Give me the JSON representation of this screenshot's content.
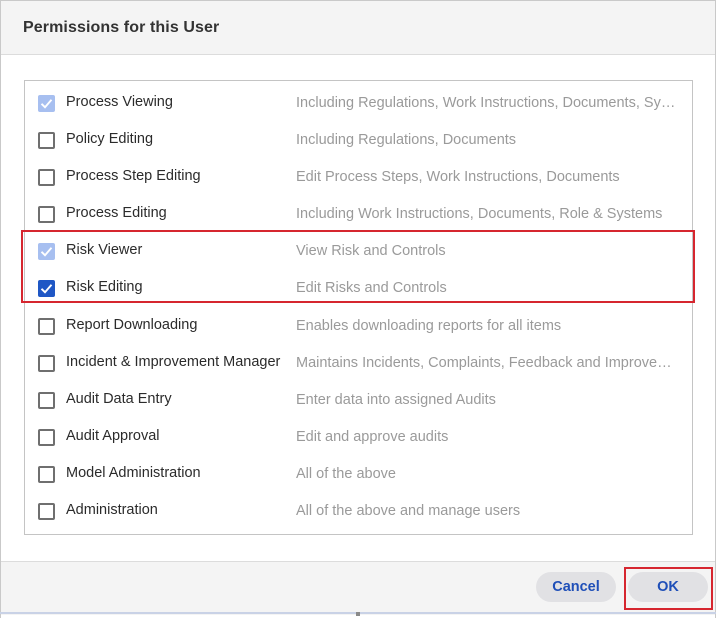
{
  "dialog": {
    "title": "Permissions for this User"
  },
  "permissions": [
    {
      "name": "Process Viewing",
      "description": "Including Regulations, Work Instructions, Documents, Sy…",
      "state": "checked-disabled"
    },
    {
      "name": "Policy Editing",
      "description": "Including Regulations, Documents",
      "state": "unchecked"
    },
    {
      "name": "Process Step Editing",
      "description": "Edit Process Steps, Work Instructions, Documents",
      "state": "unchecked"
    },
    {
      "name": "Process Editing",
      "description": "Including Work Instructions, Documents, Role & Systems",
      "state": "unchecked"
    },
    {
      "name": "Risk Viewer",
      "description": "View Risk and Controls",
      "state": "checked-disabled"
    },
    {
      "name": "Risk Editing",
      "description": "Edit Risks and Controls",
      "state": "checked"
    },
    {
      "name": "Report Downloading",
      "description": "Enables downloading reports for all items",
      "state": "unchecked"
    },
    {
      "name": "Incident & Improvement Manager",
      "description": "Maintains Incidents, Complaints, Feedback and Improve…",
      "state": "unchecked"
    },
    {
      "name": "Audit Data Entry",
      "description": "Enter data into assigned Audits",
      "state": "unchecked"
    },
    {
      "name": "Audit Approval",
      "description": "Edit and approve audits",
      "state": "unchecked"
    },
    {
      "name": "Model Administration",
      "description": "All of the above",
      "state": "unchecked"
    },
    {
      "name": "Administration",
      "description": "All of the above and manage users",
      "state": "unchecked"
    }
  ],
  "footer": {
    "cancel_label": "Cancel",
    "ok_label": "OK"
  },
  "colors": {
    "checked": "#1f57c5",
    "checked_disabled": "#a7bff0",
    "highlight": "#d6262f",
    "button_text": "#1f4fb8"
  }
}
